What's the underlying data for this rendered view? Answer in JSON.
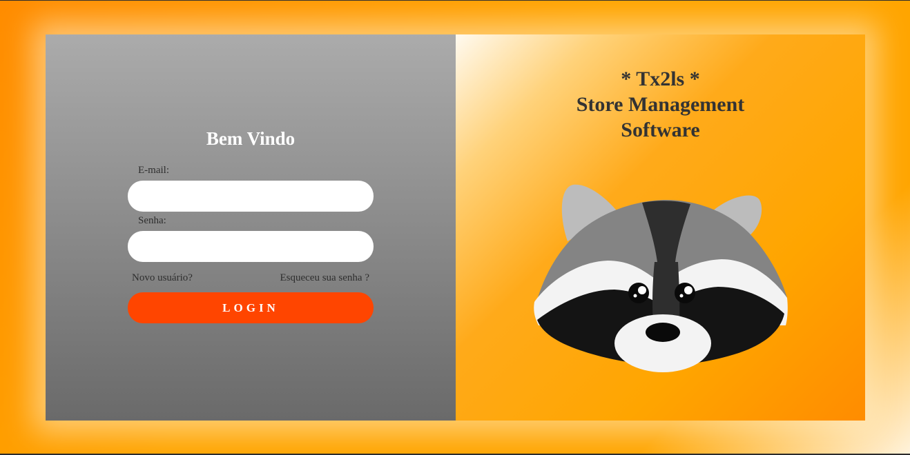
{
  "login": {
    "title": "Bem Vindo",
    "email_label": "E-mail:",
    "email_value": "",
    "password_label": "Senha:",
    "password_value": "",
    "new_user_link": "Novo usuário?",
    "forgot_link": "Esqueceu sua senha ?",
    "login_button": "LOGIN"
  },
  "brand": {
    "title_line1": "* Tx2ls *",
    "title_line2": "Store Management",
    "title_line3": "Software",
    "mascot_icon": "raccoon-icon"
  },
  "colors": {
    "accent": "#ff4500",
    "background": "#ffa500",
    "panel_gray": "#8a8a8a"
  }
}
